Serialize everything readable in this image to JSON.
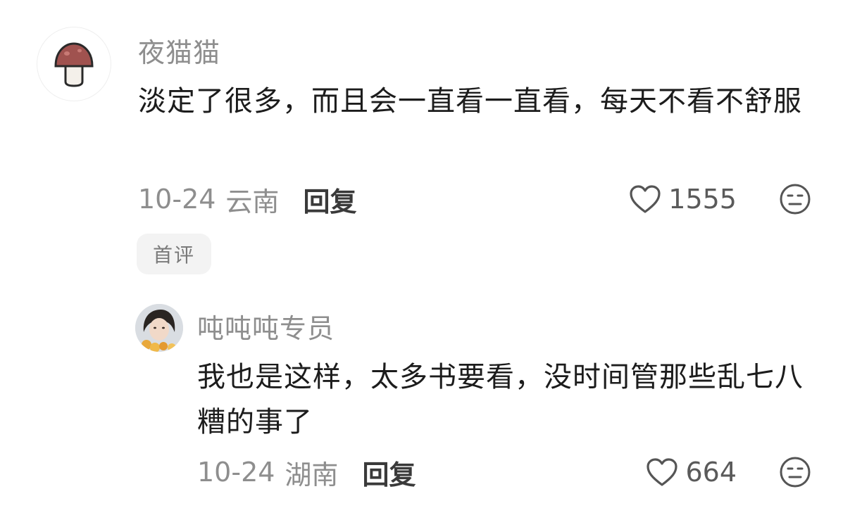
{
  "comment": {
    "username": "夜猫猫",
    "content": "淡定了很多，而且会一直看一直看，每天不看不舒服",
    "date": "10-24",
    "location": "云南",
    "reply_label": "回复",
    "like_count": "1555",
    "badge": "首评",
    "avatar_icon": "mushroom-icon"
  },
  "reply": {
    "username": "吨吨吨专员",
    "content": "我也是这样，太多书要看，没时间管那些乱七八糟的事了",
    "date": "10-24",
    "location": "湖南",
    "reply_label": "回复",
    "like_count": "664",
    "avatar_icon": "user-photo-avatar"
  },
  "icons": {
    "like": "heart-outline-icon",
    "reaction": "neutral-face-icon"
  },
  "colors": {
    "username": "#8e8e8e",
    "content": "#1c1c1c",
    "meta": "#8e8e8e",
    "badge_bg": "#f3f3f3",
    "mushroom_cap": "#a0524f"
  }
}
